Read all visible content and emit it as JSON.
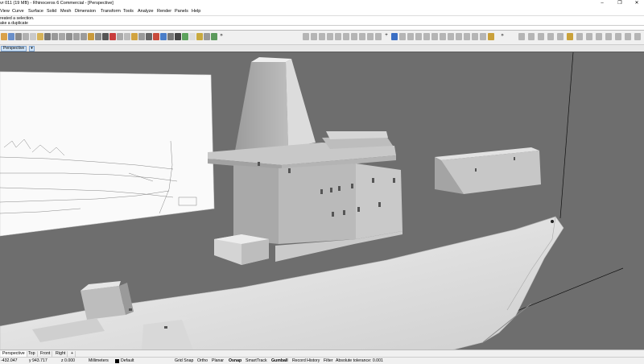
{
  "window": {
    "title": "vr 011 (19 MB) - Rhinoceros 6 Commercial - [Perspective]",
    "minimize": "–",
    "maximize": "❐",
    "close": "✕"
  },
  "menu": [
    "View",
    "Curve",
    "Surface",
    "Solid",
    "Mesh",
    "Dimension",
    "Transform",
    "Tools",
    "Analyze",
    "Render",
    "Panels",
    "Help"
  ],
  "command": {
    "history_1": "reated a selection.",
    "history_2": "ake a duplicate",
    "prompt": ""
  },
  "viewport": {
    "active_tab": "Perspective",
    "menu_arrow": "▾"
  },
  "layout_tabs": [
    "Perspective",
    "Top",
    "Front",
    "Right",
    "+"
  ],
  "status": {
    "x": "-432.047",
    "y": "y 943.717",
    "z": "z 0.000",
    "units": "Millimeters",
    "layer": "Default",
    "layer_color": "#000000",
    "grid_snap": "Grid Snap",
    "ortho": "Ortho",
    "planar": "Planar",
    "osnap": "Osnap",
    "smarttrack": "SmartTrack",
    "gumball": "Gumball",
    "record_history": "Record History",
    "filter": "Filter",
    "tolerance": "Absolute tolerance: 0.001"
  },
  "colors": {
    "viewport_bg": "#6e6e6e",
    "model_light": "#e8e8e8",
    "model_mid": "#c4c4c4",
    "model_dark": "#9a9a9a"
  }
}
